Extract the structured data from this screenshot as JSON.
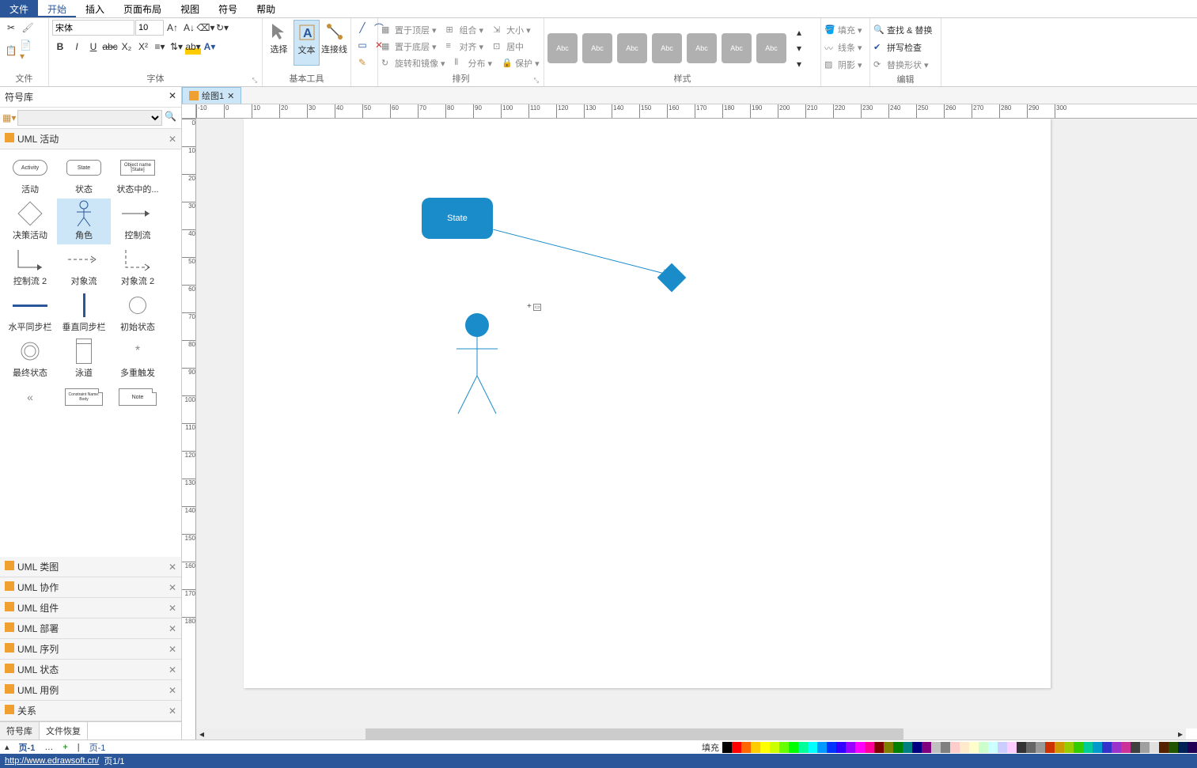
{
  "menubar": {
    "file": "文件",
    "start": "开始",
    "insert": "插入",
    "layout": "页面布局",
    "view": "视图",
    "symbol": "符号",
    "help": "帮助"
  },
  "ribbon": {
    "groups": {
      "file": "文件",
      "font": "字体",
      "tools": "基本工具",
      "arrange": "排列",
      "style": "样式",
      "edit": "编辑"
    },
    "font_name": "宋体",
    "font_size": "10",
    "select": "选择",
    "text": "文本",
    "connector": "连接线",
    "top": "置于顶层",
    "bottom": "置于底层",
    "rotate": "旋转和镜像",
    "group": "组合",
    "align": "对齐",
    "distribute": "分布",
    "size": "大小",
    "center": "居中",
    "protect": "保护",
    "fill": "填充",
    "line": "线条",
    "shadow": "阴影",
    "find": "查找 & 替换",
    "spell": "拼写检查",
    "replace_shape": "替换形状",
    "style_label": "Abc"
  },
  "symbols": {
    "title": "符号库",
    "current_cat": "UML 活动",
    "shapes": [
      {
        "l": "活动",
        "thumb": "Activity"
      },
      {
        "l": "状态",
        "thumb": "State"
      },
      {
        "l": "状态中的...",
        "thumb": "Object name [State]"
      },
      {
        "l": "决策活动"
      },
      {
        "l": "角色"
      },
      {
        "l": "控制流"
      },
      {
        "l": "控制流 2"
      },
      {
        "l": "对象流"
      },
      {
        "l": "对象流 2"
      },
      {
        "l": "水平同步栏"
      },
      {
        "l": "垂直同步栏"
      },
      {
        "l": "初始状态"
      },
      {
        "l": "最终状态"
      },
      {
        "l": "泳道"
      },
      {
        "l": "多重触发"
      },
      {
        "l": ""
      },
      {
        "l": ""
      },
      {
        "l": ""
      }
    ],
    "constraint_label": "Constraint Name: Body",
    "note_label": "Note",
    "cats": [
      "UML 类图",
      "UML 协作",
      "UML 组件",
      "UML 部署",
      "UML 序列",
      "UML 状态",
      "UML 用例",
      "关系"
    ],
    "tabs": {
      "lib": "符号库",
      "recover": "文件恢复"
    }
  },
  "canvas": {
    "tab_name": "绘图1",
    "state_text": "State",
    "ruler_h": [
      "-10",
      "0",
      "10",
      "20",
      "30",
      "40",
      "50",
      "60",
      "70",
      "80",
      "90",
      "100",
      "110",
      "120",
      "130",
      "140",
      "150",
      "160",
      "170",
      "180",
      "190",
      "200",
      "210",
      "220",
      "230",
      "240",
      "250",
      "260",
      "270",
      "280",
      "290",
      "300"
    ],
    "ruler_v": [
      "0",
      "10",
      "20",
      "30",
      "40",
      "50",
      "60",
      "70",
      "80",
      "90",
      "100",
      "110",
      "120",
      "130",
      "140",
      "150",
      "160",
      "170",
      "180"
    ]
  },
  "pagebar": {
    "page1": "页-1",
    "page_alt": "页-1",
    "fill": "填充"
  },
  "colors": [
    "#000000",
    "#ff0000",
    "#ff6600",
    "#ffcc00",
    "#ffff00",
    "#ccff00",
    "#66ff00",
    "#00ff00",
    "#00ff99",
    "#00ffff",
    "#0099ff",
    "#0033ff",
    "#3300ff",
    "#9900ff",
    "#ff00ff",
    "#ff0099",
    "#800000",
    "#808000",
    "#008000",
    "#008080",
    "#000080",
    "#800080",
    "#c0c0c0",
    "#808080",
    "#ffcccc",
    "#ffebcc",
    "#ffffcc",
    "#ccffcc",
    "#ccffff",
    "#ccccff",
    "#ffccff",
    "#333333",
    "#666666",
    "#999999",
    "#cc3300",
    "#cc9900",
    "#99cc00",
    "#33cc00",
    "#00cc99",
    "#0099cc",
    "#3333cc",
    "#9933cc",
    "#cc3399",
    "#404040",
    "#a0a0a0",
    "#e0e0e0",
    "#552200",
    "#225500",
    "#002255",
    "#220055"
  ],
  "status": {
    "url": "http://www.edrawsoft.cn/",
    "page": "页1/1"
  }
}
